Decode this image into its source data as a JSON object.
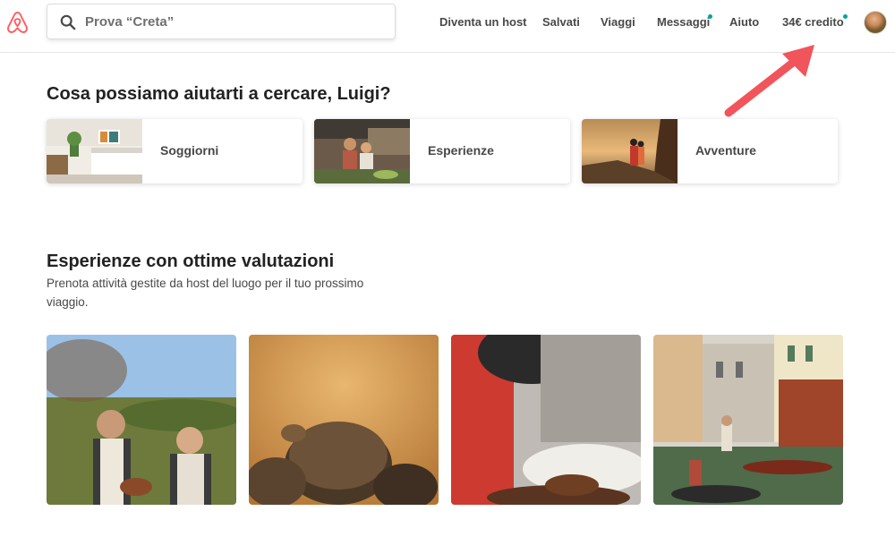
{
  "header": {
    "logo_icon": "airbnb-logo-icon",
    "search": {
      "placeholder": "Prova “Creta”",
      "icon": "search-icon"
    },
    "nav": {
      "host": "Diventa un host",
      "saved": "Salvati",
      "trips": "Viaggi",
      "messages": "Messaggi",
      "help": "Aiuto",
      "credit": "34€ credito"
    },
    "notification_color": "#00a699"
  },
  "annotation": {
    "arrow_color": "#f2545b",
    "icon": "arrow-up-right-icon"
  },
  "categories": {
    "title": "Cosa possiamo aiutarti a cercare, Luigi?",
    "items": [
      {
        "label": "Soggiorni"
      },
      {
        "label": "Esperienze"
      },
      {
        "label": "Avventure"
      }
    ]
  },
  "experiences": {
    "title": "Esperienze con ottime valutazioni",
    "subtitle": "Prenota attività gestite da host del luogo per il tuo prossimo viaggio."
  },
  "brand_color": "#ff5a5f"
}
